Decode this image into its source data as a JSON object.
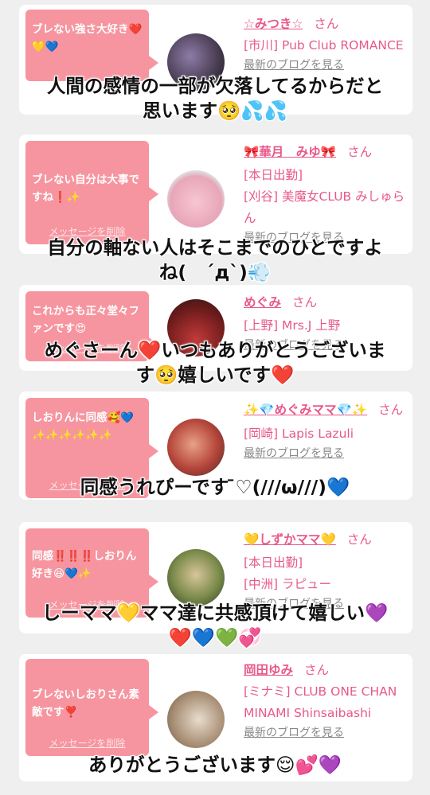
{
  "cards": [
    {
      "message": "ブレない強さ大好き❤️💛💙",
      "delete_label": "",
      "name": "☆みつき☆",
      "san": "さん",
      "shop": "[市川] Pub Club ROMANCE",
      "blog_label": "最新のブログを見る"
    },
    {
      "message": "ブレない自分は大事ですね❗✨",
      "delete_label": "メッセージを削除",
      "name": "🎀華月　みゆ🎀",
      "san": "さん",
      "shop_line1": "[本日出勤]",
      "shop": "[刈谷] 美魔女CLUB みしゅらん",
      "blog_label": "最新のブログを見る"
    },
    {
      "message": "これからも正々堂々ファンです😍",
      "delete_label": "メッセージを削除",
      "name": "めぐみ",
      "san": "さん",
      "shop": "[上野] Mrs.J 上野",
      "blog_label": "最新のブログを見る"
    },
    {
      "message": "しおりんに同感🥰💙✨✨✨✨✨✨",
      "delete_label": "メッセージを削除",
      "name": "✨💎めぐみママ💎✨",
      "san": "さん",
      "shop": "[岡崎] Lapis Lazuli",
      "blog_label": "最新のブログを見る"
    },
    {
      "message": "同感‼️‼️‼️しおりん好き😆💙✨",
      "delete_label": "メッセージを削除",
      "name": "💛しずかママ💛",
      "san": "さん",
      "shop_line1": "[本日出勤]",
      "shop": "[中洲] ラピュー",
      "blog_label": "最新のブログを見る"
    },
    {
      "message": "ブレないしおりさん素敵です❣️",
      "delete_label": "メッセージを削除",
      "name": "岡田ゆみ",
      "san": "さん",
      "shop": "[ミナミ] CLUB ONE CHAN MINAMI Shinsaibashi",
      "blog_label": "最新のブログを見る"
    }
  ],
  "overlays": [
    "人間の感情の一部が欠落してるからだと\n思います🥺💦💦",
    "自分の軸ない人はそこまでのひとですよ\nね(　´д`)💨",
    "めぐさーん❤️いつもありがとうございま\nす🥺嬉しいです❤️",
    "同感うれぴーです ̄♡(///ω///)💙",
    "しーママ💛ママ達に共感頂けて嬉しい💜\n❤️💙💚💞",
    "ありがとうございます😌💕💜"
  ]
}
